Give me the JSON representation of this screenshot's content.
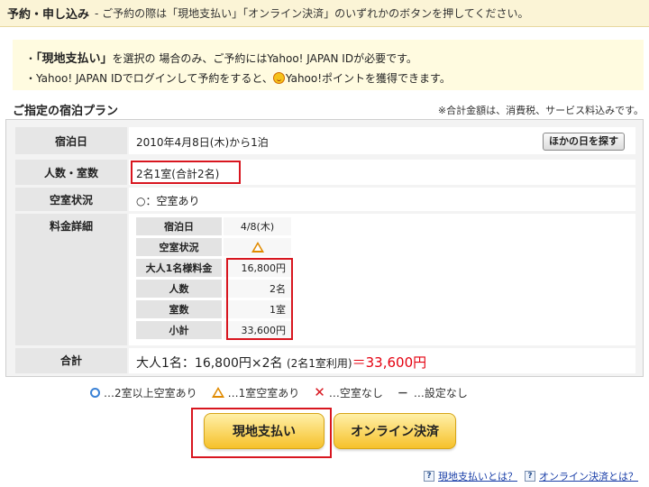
{
  "header": {
    "title": "予約・申し込み",
    "subtitle": "- ご予約の際は「現地支払い」「オンライン決済」のいずれかのボタンを押してください。"
  },
  "notice": {
    "line1_prefix": "・",
    "line1_bold": "「現地支払い」",
    "line1_rest": "を選択の 場合のみ、ご予約にはYahoo! JAPAN IDが必要です。",
    "line2_prefix": "・Yahoo! JAPAN IDでログインして予約をすると、",
    "line2_rest": "Yahoo!ポイントを獲得できます。"
  },
  "plan": {
    "title": "ご指定の宿泊プラン",
    "tax_note": "※合計金額は、消費税、サービス料込みです。"
  },
  "rows": {
    "date_label": "宿泊日",
    "date_value": "2010年4月8日(木)から1泊",
    "other_date_button": "ほかの日を探す",
    "persons_label": "人数・室数",
    "persons_value": "2名1室(合計2名)",
    "vacancy_label": "空室状況",
    "vacancy_value": "○：空室あり",
    "fee_label": "料金詳細",
    "total_label": "合計"
  },
  "fee_table": [
    {
      "label": "宿泊日",
      "value": "4/8(木)"
    },
    {
      "label": "空室状況",
      "value": ""
    },
    {
      "label": "大人1名様料金",
      "value": "16,800円"
    },
    {
      "label": "人数",
      "value": "2名"
    },
    {
      "label": "室数",
      "value": "1室"
    },
    {
      "label": "小計",
      "value": "33,600円"
    }
  ],
  "total": {
    "formula": "大人1名：16,800円×2名",
    "rooms": "(2名1室利用)",
    "amount": "＝33,600円"
  },
  "legend": {
    "circle": "…2室以上空室あり",
    "triangle": "…1室空室あり",
    "cross": "…空室なし",
    "dash_symbol": "－",
    "dash": "…設定なし"
  },
  "buttons": {
    "local_pay": "現地支払い",
    "online_pay": "オンライン決済"
  },
  "links": {
    "icon": "?",
    "local_pay_help": "現地支払いとは？",
    "online_pay_help": "オンライン決済とは？"
  },
  "colors": {
    "highlight_red": "#d8161f",
    "price_red": "#e4000f",
    "button_gold": "#f6c12a"
  }
}
